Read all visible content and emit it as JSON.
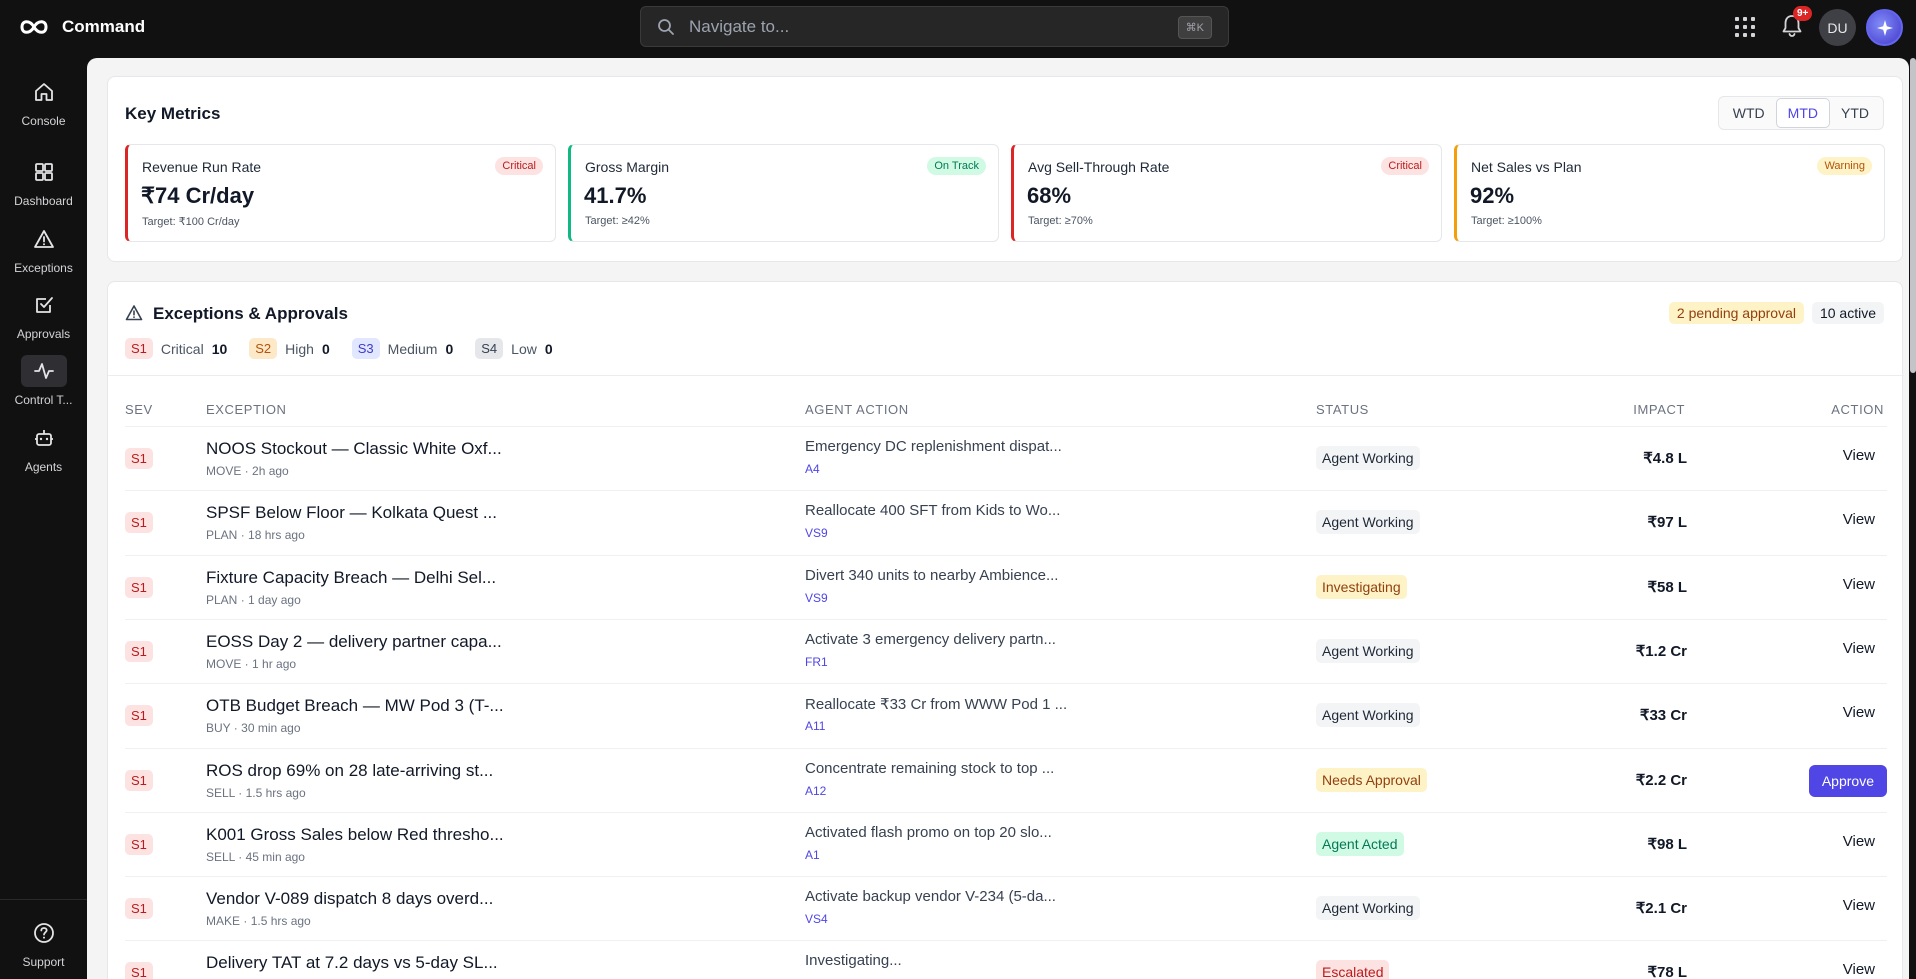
{
  "app": {
    "name": "Command"
  },
  "search": {
    "placeholder": "Navigate to...",
    "shortcut": "⌘K"
  },
  "topbar": {
    "notifications_badge": "9+",
    "avatar_initials": "DU"
  },
  "sidebar": {
    "items": [
      {
        "label": "Console",
        "icon": "home-icon"
      },
      {
        "label": "Dashboard",
        "icon": "dashboard-icon"
      },
      {
        "label": "Exceptions",
        "icon": "warning-icon"
      },
      {
        "label": "Approvals",
        "icon": "check-square-icon"
      },
      {
        "label": "Control T...",
        "icon": "activity-icon",
        "active": true
      },
      {
        "label": "Agents",
        "icon": "robot-icon"
      }
    ],
    "footer": {
      "label": "Support",
      "icon": "help-circle-icon"
    }
  },
  "metrics": {
    "title": "Key Metrics",
    "periods": [
      "WTD",
      "MTD",
      "YTD"
    ],
    "active_period": "MTD",
    "cards": [
      {
        "label": "Revenue Run Rate",
        "value": "₹74 Cr/day",
        "target": "Target: ₹100 Cr/day",
        "badge": "Critical",
        "accent": "#dc2626"
      },
      {
        "label": "Gross Margin",
        "value": "41.7%",
        "target": "Target: ≥42%",
        "badge": "On Track",
        "accent": "#10b981"
      },
      {
        "label": "Avg Sell-Through Rate",
        "value": "68%",
        "target": "Target: ≥70%",
        "badge": "Critical",
        "accent": "#dc2626"
      },
      {
        "label": "Net Sales vs Plan",
        "value": "92%",
        "target": "Target: ≥100%",
        "badge": "Warning",
        "accent": "#f59e0b"
      }
    ]
  },
  "exceptions": {
    "title": "Exceptions & Approvals",
    "pending_label": "2 pending approval",
    "active_label": "10 active",
    "severity_summary": [
      {
        "code": "S1",
        "name": "Critical",
        "count": "10"
      },
      {
        "code": "S2",
        "name": "High",
        "count": "0"
      },
      {
        "code": "S3",
        "name": "Medium",
        "count": "0"
      },
      {
        "code": "S4",
        "name": "Low",
        "count": "0"
      }
    ],
    "columns": {
      "sev": "SEV",
      "exception": "EXCEPTION",
      "agent_action": "AGENT ACTION",
      "status": "STATUS",
      "impact": "IMPACT",
      "action": "ACTION"
    },
    "rows": [
      {
        "sev": "S1",
        "title": "NOOS Stockout — Classic White Oxf...",
        "module": "MOVE",
        "time": "2h ago",
        "agent_action": "Emergency DC replenishment dispat...",
        "agent_code": "A4",
        "status": "Agent Working",
        "status_type": "working",
        "impact": "₹4.8 L",
        "action": "View"
      },
      {
        "sev": "S1",
        "title": "SPSF Below Floor — Kolkata Quest ...",
        "module": "PLAN",
        "time": "18 hrs ago",
        "agent_action": "Reallocate 400 SFT from Kids to Wo...",
        "agent_code": "VS9",
        "status": "Agent Working",
        "status_type": "working",
        "impact": "₹97 L",
        "action": "View"
      },
      {
        "sev": "S1",
        "title": "Fixture Capacity Breach — Delhi Sel...",
        "module": "PLAN",
        "time": "1 day ago",
        "agent_action": "Divert 340 units to nearby Ambience...",
        "agent_code": "VS9",
        "status": "Investigating",
        "status_type": "investigating",
        "impact": "₹58 L",
        "action": "View"
      },
      {
        "sev": "S1",
        "title": "EOSS Day 2 — delivery partner capa...",
        "module": "MOVE",
        "time": "1 hr ago",
        "agent_action": "Activate 3 emergency delivery partn...",
        "agent_code": "FR1",
        "status": "Agent Working",
        "status_type": "working",
        "impact": "₹1.2 Cr",
        "action": "View"
      },
      {
        "sev": "S1",
        "title": "OTB Budget Breach — MW Pod 3 (T-...",
        "module": "BUY",
        "time": "30 min ago",
        "agent_action": "Reallocate ₹33 Cr from WWW Pod 1 ...",
        "agent_code": "A11",
        "status": "Agent Working",
        "status_type": "working",
        "impact": "₹33 Cr",
        "action": "View"
      },
      {
        "sev": "S1",
        "title": "ROS drop 69% on 28 late-arriving st...",
        "module": "SELL",
        "time": "1.5 hrs ago",
        "agent_action": "Concentrate remaining stock to top ...",
        "agent_code": "A12",
        "status": "Needs Approval",
        "status_type": "approval",
        "impact": "₹2.2 Cr",
        "action": "Approve"
      },
      {
        "sev": "S1",
        "title": "K001 Gross Sales below Red thresho...",
        "module": "SELL",
        "time": "45 min ago",
        "agent_action": "Activated flash promo on top 20 slo...",
        "agent_code": "A1",
        "status": "Agent Acted",
        "status_type": "acted",
        "impact": "₹98 L",
        "action": "View"
      },
      {
        "sev": "S1",
        "title": "Vendor V-089 dispatch 8 days overd...",
        "module": "MAKE",
        "time": "1.5 hrs ago",
        "agent_action": "Activate backup vendor V-234 (5-da...",
        "agent_code": "VS4",
        "status": "Agent Working",
        "status_type": "working",
        "impact": "₹2.1 Cr",
        "action": "View"
      },
      {
        "sev": "S1",
        "title": "Delivery TAT at 7.2 days vs 5-day SL...",
        "module": "",
        "time": "",
        "agent_action": "Investigating...",
        "agent_code": "",
        "status": "Escalated",
        "status_type": "escalated",
        "impact": "₹78 L",
        "action": "View"
      }
    ]
  }
}
